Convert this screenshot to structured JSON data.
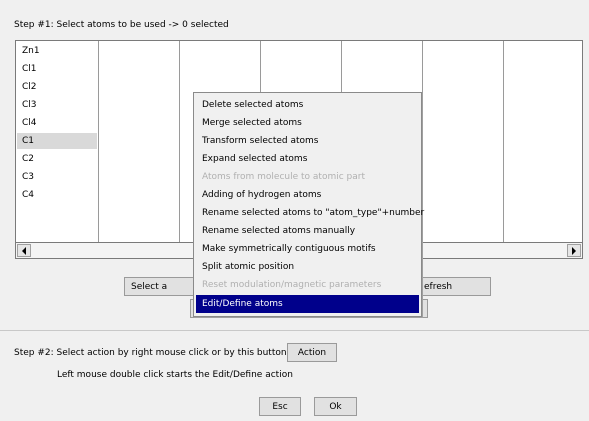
{
  "step1": {
    "label": "Step #1: Select atoms to be used  -> 0 selected"
  },
  "atoms": [
    "Zn1",
    "Cl1",
    "Cl2",
    "Cl3",
    "Cl4",
    "C1",
    "C2",
    "C3",
    "C4"
  ],
  "selected_atom": "C1",
  "buttons": {
    "select_all": "Select a",
    "refresh": "efresh",
    "action": "Action",
    "esc": "Esc",
    "ok": "Ok"
  },
  "context_menu": {
    "items": [
      {
        "label": "Delete selected atoms",
        "enabled": true
      },
      {
        "label": "Merge selected atoms",
        "enabled": true
      },
      {
        "label": "Transform selected atoms",
        "enabled": true
      },
      {
        "label": "Expand selected atoms",
        "enabled": true
      },
      {
        "label": "Atoms from molecule to atomic part",
        "enabled": false
      },
      {
        "label": "Adding of hydrogen atoms",
        "enabled": true
      },
      {
        "label": "Rename selected atoms to \"atom_type\"+number",
        "enabled": true
      },
      {
        "label": "Rename selected atoms manually",
        "enabled": true
      },
      {
        "label": "Make symmetrically contiguous motifs",
        "enabled": true
      },
      {
        "label": "Split atomic position",
        "enabled": true
      },
      {
        "label": "Reset modulation/magnetic parameters",
        "enabled": false
      },
      {
        "label": "Edit/Define atoms",
        "enabled": true,
        "highlighted": true
      }
    ]
  },
  "step2": {
    "label": "Step #2: Select action by right mouse click or by this button:",
    "hint": "Left mouse double click starts the Edit/Define action"
  },
  "colors": {
    "menu_highlight": "#00008b",
    "selected_row": "#d9d9d9"
  }
}
